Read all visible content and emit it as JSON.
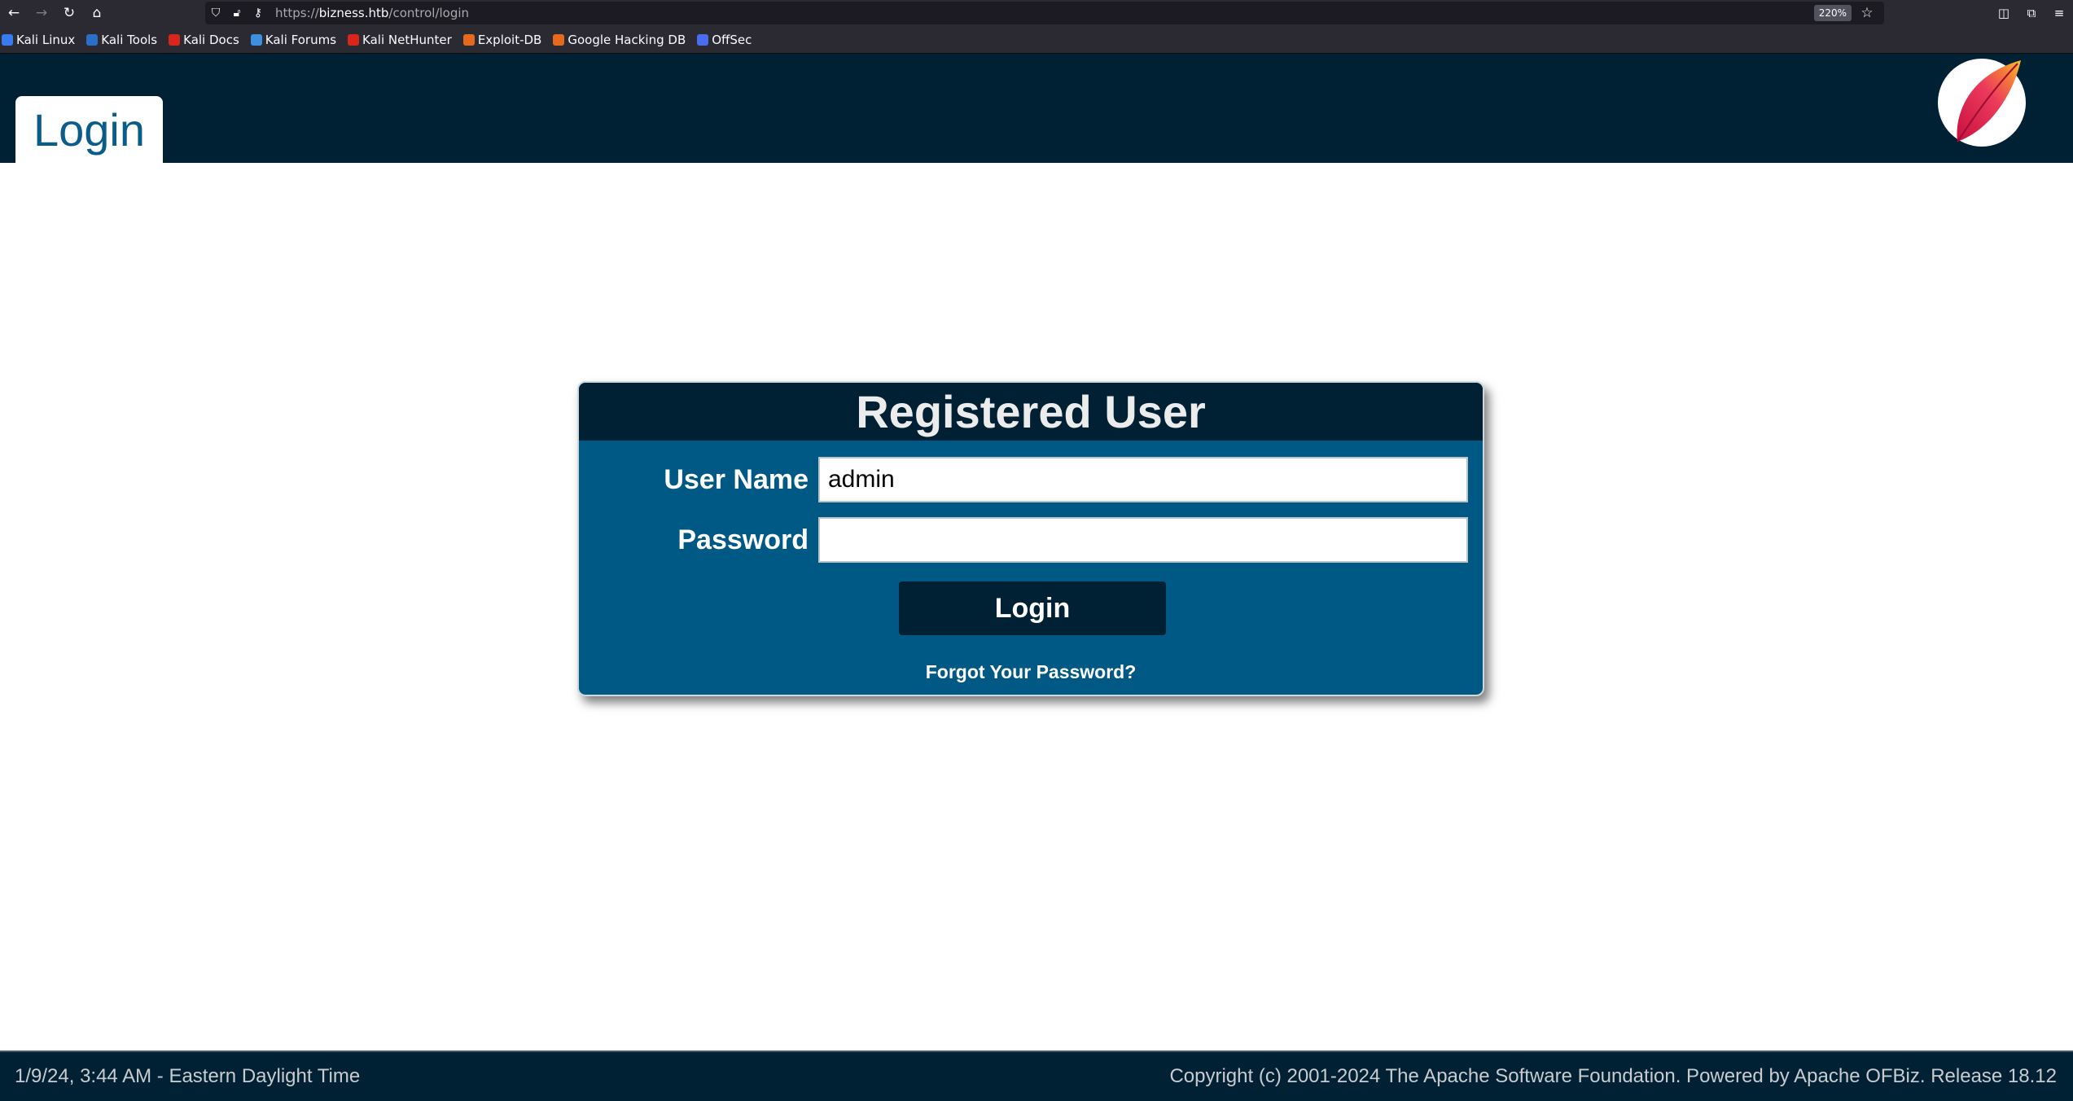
{
  "browser": {
    "url_prefix": "https://",
    "url_host": "bizness.htb",
    "url_path": "/control/login",
    "zoom": "220%",
    "bookmarks": [
      {
        "label": "Kali Linux",
        "color": "#367bf0"
      },
      {
        "label": "Kali Tools",
        "color": "#2a6ec6"
      },
      {
        "label": "Kali Docs",
        "color": "#d9261c"
      },
      {
        "label": "Kali Forums",
        "color": "#3d8fe0"
      },
      {
        "label": "Kali NetHunter",
        "color": "#d9261c"
      },
      {
        "label": "Exploit-DB",
        "color": "#e56a1e"
      },
      {
        "label": "Google Hacking DB",
        "color": "#e56a1e"
      },
      {
        "label": "OffSec",
        "color": "#4b6cf0"
      }
    ]
  },
  "header": {
    "tab_title": "Login"
  },
  "login": {
    "title": "Registered User",
    "username_label": "User Name",
    "username_value": "admin",
    "password_label": "Password",
    "password_value": "",
    "submit_label": "Login",
    "forgot_label": "Forgot Your Password?"
  },
  "footer": {
    "datetime": "1/9/24, 3:44 AM - Eastern Daylight Time",
    "copyright": "Copyright (c) 2001-2024 The Apache Software Foundation. Powered by Apache OFBiz. Release 18.12"
  },
  "colors": {
    "header_bg": "#002033",
    "panel_bg": "#005984",
    "accent": "#0a5c8a"
  }
}
